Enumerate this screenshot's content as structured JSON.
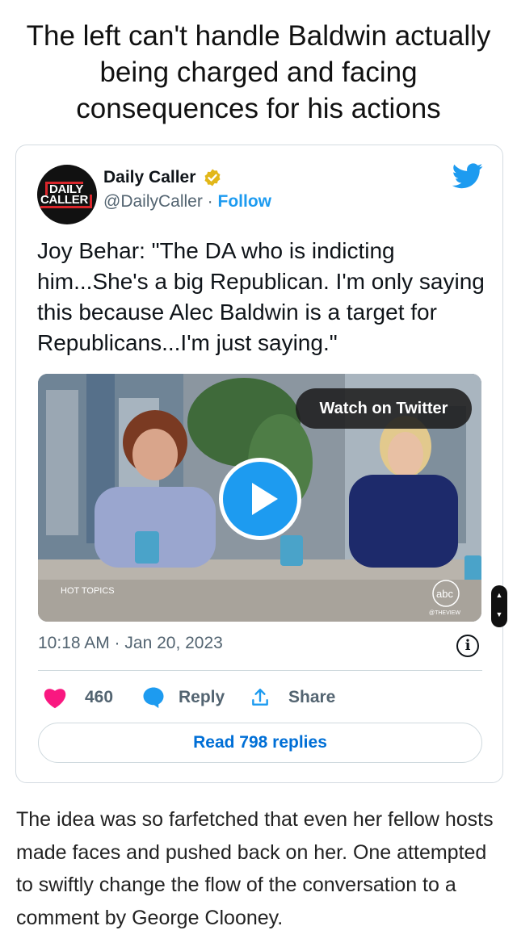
{
  "headline": "The left can't handle Baldwin actually being charged and facing consequences for his actions",
  "tweet": {
    "avatar": {
      "line1": "DAILY",
      "line2": "CALLER"
    },
    "author_name": "Daily Caller",
    "handle": "@DailyCaller",
    "separator": " · ",
    "follow_label": "Follow",
    "text": "Joy Behar: \"The DA who is indicting him...She's a big Republican. I'm only saying this because Alec Baldwin is a target for Republicans...I'm just saying.\"",
    "media": {
      "watch_label": "Watch on Twitter",
      "overlay_hot_topics": "HOT TOPICS",
      "overlay_abc": "abc",
      "overlay_theview": "@THEVIEW"
    },
    "timestamp": "10:18 AM · Jan 20, 2023",
    "info_label": "i",
    "likes": "460",
    "reply_label": "Reply",
    "share_label": "Share",
    "read_replies_label": "Read 798 replies"
  },
  "caption": "The idea was so farfetched that even her fellow hosts made faces and pushed back on her. One attempted to swiftly change the flow of the conversation to a comment by George Clooney.",
  "colors": {
    "twitter_blue": "#1d9bf0",
    "like_red": "#f91880",
    "verified_gold": "#e2b719",
    "link_blue": "#006fd6"
  }
}
